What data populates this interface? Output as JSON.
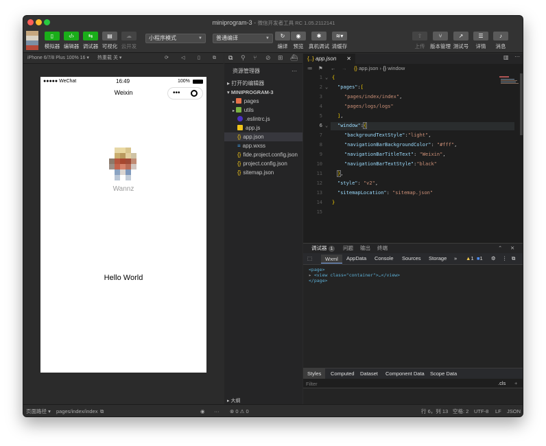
{
  "window": {
    "title": "miniprogram-3",
    "subtitle": "微信开发者工具 RC 1.05.2112141"
  },
  "toolbar": {
    "left_buttons": [
      {
        "label": "模拟器",
        "icon": "phone-icon"
      },
      {
        "label": "编辑器",
        "icon": "code-icon"
      },
      {
        "label": "调试器",
        "icon": "debug-icon"
      },
      {
        "label": "可视化",
        "icon": "layout-icon"
      },
      {
        "label": "云开发",
        "icon": "cloud-icon"
      }
    ],
    "mode_select": "小程序模式",
    "compile_select": "普通编译",
    "mid_buttons": [
      {
        "label": "编译",
        "icon": "refresh-icon"
      },
      {
        "label": "预览",
        "icon": "eye-icon"
      },
      {
        "label": "真机调试",
        "icon": "bug-icon"
      },
      {
        "label": "清缓存",
        "icon": "layers-icon"
      }
    ],
    "right_buttons": [
      {
        "label": "上传",
        "icon": "upload-icon"
      },
      {
        "label": "版本管理",
        "icon": "branch-icon"
      },
      {
        "label": "测试号",
        "icon": "external-link-icon"
      },
      {
        "label": "详情",
        "icon": "menu-icon"
      },
      {
        "label": "消息",
        "icon": "bell-icon"
      }
    ]
  },
  "simulator": {
    "device": "iPhone 6/7/8 Plus 100% 16",
    "hotreload": "热重载 关",
    "status_left": "●●●●● WeChat",
    "status_time": "16:49",
    "status_battery": "100%",
    "nav_title": "Weixin",
    "username": "Wannz",
    "hello": "Hello World"
  },
  "explorer": {
    "title": "资源管理器",
    "open_editors": "打开的编辑器",
    "project": "MINIPROGRAM-3",
    "files": [
      {
        "name": "pages",
        "type": "folder"
      },
      {
        "name": "utils",
        "type": "folder"
      },
      {
        "name": ".eslintrc.js",
        "type": "eslint"
      },
      {
        "name": "app.js",
        "type": "js"
      },
      {
        "name": "app.json",
        "type": "json"
      },
      {
        "name": "app.wxss",
        "type": "wxss"
      },
      {
        "name": "fide.project.config.json",
        "type": "json"
      },
      {
        "name": "project.config.json",
        "type": "json"
      },
      {
        "name": "sitemap.json",
        "type": "json"
      }
    ],
    "outline": "大纲"
  },
  "editor": {
    "tab": "app.json",
    "tab_icon": "{..}",
    "breadcrumb_file": "app.json",
    "breadcrumb_node": "window",
    "line_numbers": [
      "1",
      "2",
      "3",
      "4",
      "5",
      "6",
      "7",
      "8",
      "9",
      "10",
      "11",
      "12",
      "13",
      "14",
      "15"
    ]
  },
  "panel": {
    "tabs": [
      "调试器",
      "问题",
      "输出",
      "终端"
    ],
    "debugger_badge": "1",
    "devtools_tabs": [
      "Wxml",
      "AppData",
      "Console",
      "Sources",
      "Storage"
    ],
    "warnings": "1",
    "messages": "1",
    "wxml_lines": [
      "<page>",
      "<view class=\"container\">…</view>",
      "</page>"
    ],
    "style_tabs": [
      "Styles",
      "Computed",
      "Dataset",
      "Component Data",
      "Scope Data"
    ],
    "filter_placeholder": "Filter",
    "cls": ".cls"
  },
  "statusbar": {
    "path_label": "页面路径",
    "path": "pages/index/index",
    "errors": "0",
    "warnings": "0",
    "position": "行 6，列 13",
    "spaces": "空格: 2",
    "encoding": "UTF-8",
    "eol": "LF",
    "language": "JSON"
  },
  "colors": {
    "accent_green": "#1aad19",
    "editor_bg": "#1e1e1e",
    "json_key": "#9cdcfe",
    "json_string": "#ce9178"
  }
}
